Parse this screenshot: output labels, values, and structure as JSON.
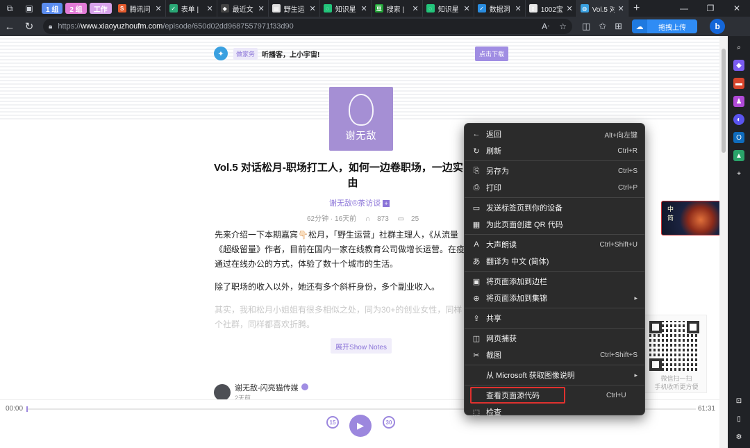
{
  "tabbar": {
    "groups": [
      {
        "label": "1 组",
        "color": "#5b8def"
      },
      {
        "label": "2 组",
        "color": "#e27bd6"
      },
      {
        "label": "工作",
        "color": "#d7a3ea"
      }
    ],
    "tabs": [
      {
        "title": "腾讯问",
        "icon_letter": "S",
        "icon_color": "#e55b2d"
      },
      {
        "title": "表单 |",
        "icon_letter": "✓",
        "icon_color": "#2aa876"
      },
      {
        "title": "最近文",
        "icon_letter": "◆",
        "icon_color": "#444"
      },
      {
        "title": "野生运",
        "icon_letter": "▤",
        "icon_color": "#ddd"
      },
      {
        "title": "知识星",
        "icon_letter": "◌",
        "icon_color": "#22c47a"
      },
      {
        "title": "搜索 |",
        "icon_letter": "豆",
        "icon_color": "#21a336"
      },
      {
        "title": "知识星",
        "icon_letter": "◌",
        "icon_color": "#22c47a"
      },
      {
        "title": "数据洞",
        "icon_letter": "✓",
        "icon_color": "#2a8de0"
      },
      {
        "title": "1002宝",
        "icon_letter": "▯",
        "icon_color": "#e8e8e8"
      },
      {
        "title": "Vol.5 对",
        "icon_letter": "◍",
        "icon_color": "#3aa0e0",
        "active": true
      }
    ],
    "new_tab": "+",
    "close_glyph": "✕"
  },
  "address": {
    "scheme": "https://",
    "host": "www.xiaoyuzhoufm.com",
    "path": "/episode/650d02dd9687557971f33d90",
    "upload_label": "拖拽上传"
  },
  "page": {
    "brand_tag": "做家务",
    "slogan": "听播客，上小宇宙!",
    "download_label": "点击下载",
    "cover_title": "谢无敌",
    "episode_title_line1": "Vol.5 对话松月-职场打工人，如何一边卷职场，一边实",
    "episode_title_line2": "由",
    "podcast_name": "谢无敌®茶访谈",
    "podcast_plus": "+",
    "meta_duration": "62分钟 · 16天前",
    "meta_plays": "873",
    "meta_comments": "25",
    "paragraphs": [
      "先来介绍一下本期嘉宾👇🏻松月，「野生运营」社群主理人，《从流量",
      "《超级留量》作者，目前在国内一家在线教育公司做增长运营。在疫",
      "通过在线办公的方式，体验了数十个城市的生活。"
    ],
    "paragraph2": "除了职场的收入以外，她还有多个斜杆身份，多个副业收入。",
    "paragraph3a": "其实，我和松月小姐姐有很多相似之处，同为30+的创业女性，同样",
    "paragraph3b": "个社群，同样都喜欢折腾。",
    "show_notes_label": "展开Show Notes",
    "author_name": "谢无敌-闪亮猫传媒",
    "author_time": "2天前",
    "qr_line1": "微信扫一扫",
    "qr_line2": "手机收听更方便",
    "thumb_text": "中\n简"
  },
  "player": {
    "time_current": "00:00",
    "time_total": "61:31",
    "rewind_label": "15",
    "forward_label": "30",
    "progress": 0.0
  },
  "context_menu": {
    "items": [
      {
        "icon": "←",
        "label": "返回",
        "shortcut": "Alt+向左键",
        "name": "back"
      },
      {
        "icon": "↻",
        "label": "刷新",
        "shortcut": "Ctrl+R",
        "name": "refresh"
      },
      {
        "sep": true
      },
      {
        "icon": "⎘",
        "label": "另存为",
        "shortcut": "Ctrl+S",
        "name": "save-as"
      },
      {
        "icon": "⎙",
        "label": "打印",
        "shortcut": "Ctrl+P",
        "name": "print"
      },
      {
        "sep": true
      },
      {
        "icon": "▭",
        "label": "发送标签页到你的设备",
        "shortcut": "",
        "name": "send-tab"
      },
      {
        "icon": "▦",
        "label": "为此页面创建 QR 代码",
        "shortcut": "",
        "name": "qr-code"
      },
      {
        "sep": true
      },
      {
        "icon": "A",
        "label": "大声朗读",
        "shortcut": "Ctrl+Shift+U",
        "name": "read-aloud"
      },
      {
        "icon": "あ",
        "label": "翻译为 中文 (简体)",
        "shortcut": "",
        "name": "translate"
      },
      {
        "sep": true
      },
      {
        "icon": "▣",
        "label": "将页面添加到边栏",
        "shortcut": "",
        "name": "add-sidebar"
      },
      {
        "icon": "⊕",
        "label": "将页面添加到集锦",
        "shortcut": "",
        "arrow": true,
        "name": "add-collection"
      },
      {
        "sep": true
      },
      {
        "icon": "⇪",
        "label": "共享",
        "shortcut": "",
        "name": "share"
      },
      {
        "sep": true
      },
      {
        "icon": "◫",
        "label": "网页捕获",
        "shortcut": "",
        "name": "web-capture"
      },
      {
        "icon": "✂",
        "label": "截图",
        "shortcut": "Ctrl+Shift+S",
        "name": "screenshot"
      },
      {
        "sep": true
      },
      {
        "icon": "",
        "label": "从 Microsoft 获取图像说明",
        "shortcut": "",
        "arrow": true,
        "name": "image-desc"
      },
      {
        "sep": true
      },
      {
        "icon": "",
        "label": "查看页面源代码",
        "shortcut": "Ctrl+U",
        "highlight": true,
        "name": "view-source"
      },
      {
        "icon": "⬚",
        "label": "检查",
        "shortcut": "",
        "name": "inspect"
      }
    ]
  }
}
